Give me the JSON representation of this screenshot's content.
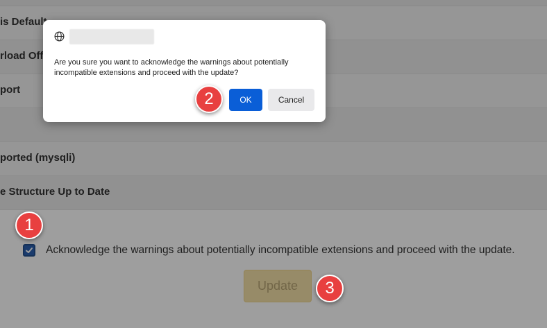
{
  "background": {
    "rows": [
      {
        "label": "is Default"
      },
      {
        "label": "rload Off"
      },
      {
        "label": "port"
      },
      {
        "label": ""
      },
      {
        "label": "ported (mysqli)"
      },
      {
        "label": "e Structure Up to Date"
      }
    ],
    "acknowledge_text": "Acknowledge the warnings about potentially incompatible extensions and proceed with the update.",
    "acknowledge_checked": true,
    "update_button": "Update"
  },
  "dialog": {
    "message": "Are you sure you want to acknowledge the warnings about potentially incompatible extensions and proceed with the update?",
    "ok_label": "OK",
    "cancel_label": "Cancel"
  },
  "markers": [
    "1",
    "2",
    "3"
  ],
  "colors": {
    "ok_button": "#0a5ed7",
    "marker": "#e84040",
    "update_button": "#f4e1a8"
  }
}
